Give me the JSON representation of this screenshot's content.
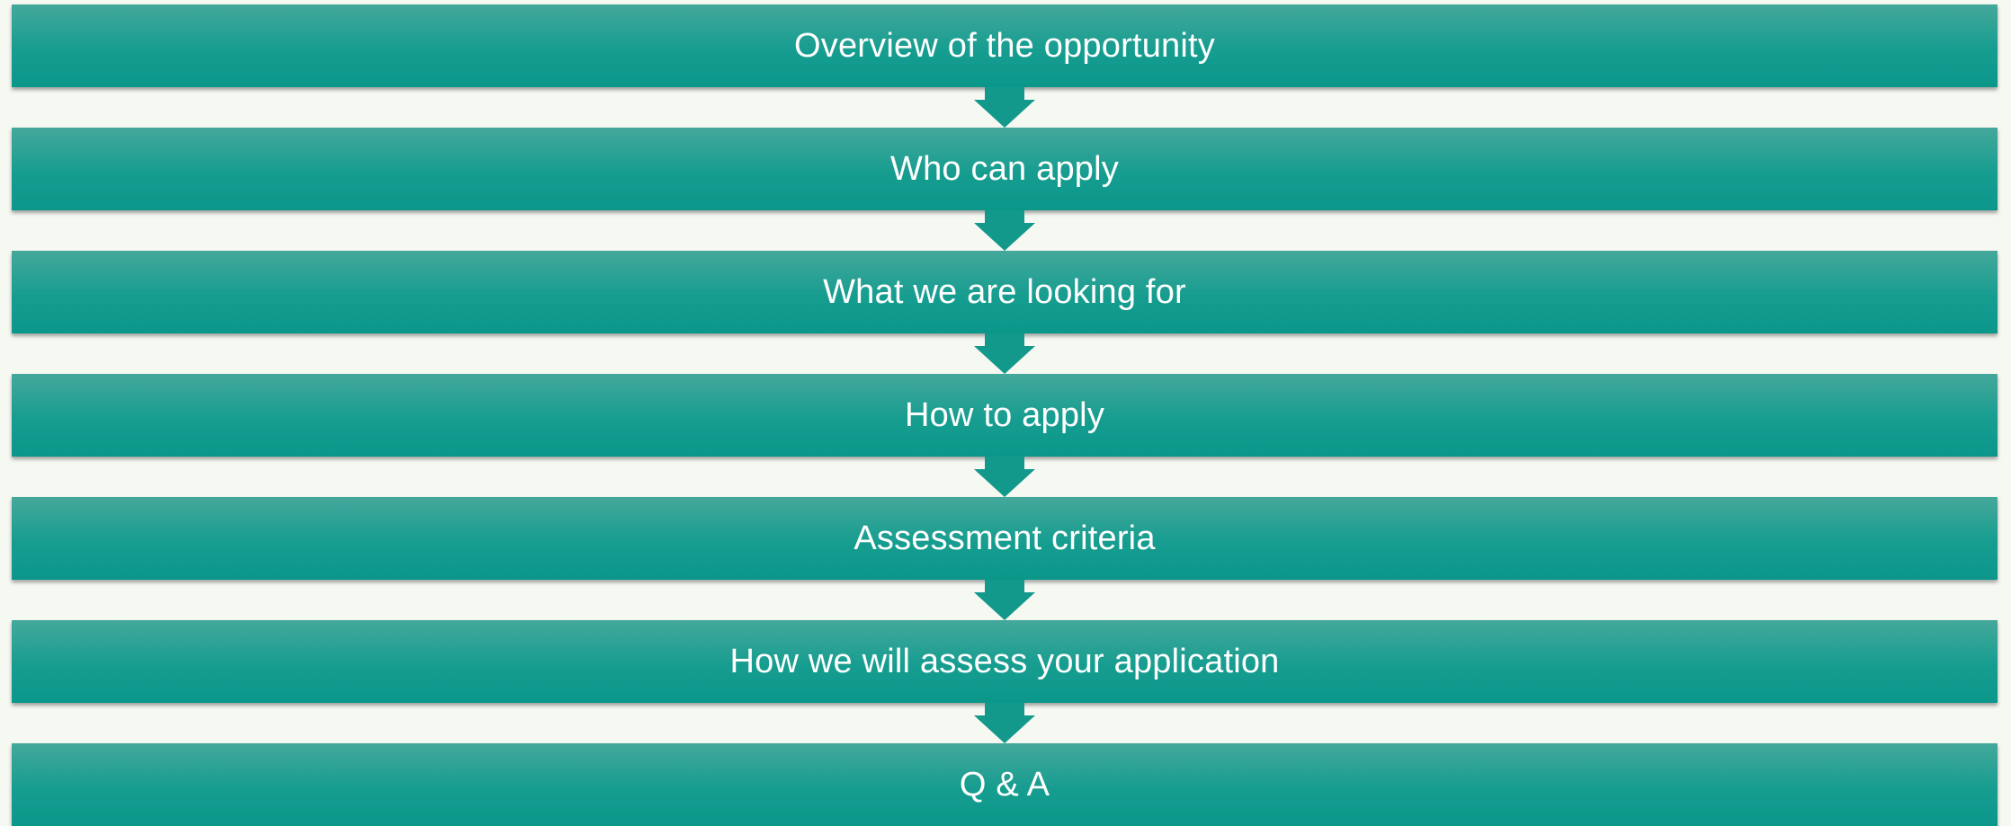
{
  "diagram": {
    "type": "vertical-process",
    "colors": {
      "background": "#f6f8f2",
      "box_top": "#44a89b",
      "box_bottom": "#0a978a",
      "arrow": "#12998c",
      "text": "#ffffff"
    },
    "steps": [
      {
        "label": "Overview of the opportunity"
      },
      {
        "label": "Who can apply"
      },
      {
        "label": "What we are looking for"
      },
      {
        "label": "How to apply"
      },
      {
        "label": "Assessment criteria"
      },
      {
        "label": "How we will assess your application"
      },
      {
        "label": "Q & A"
      }
    ],
    "connector_icon": "down-arrow-icon"
  }
}
